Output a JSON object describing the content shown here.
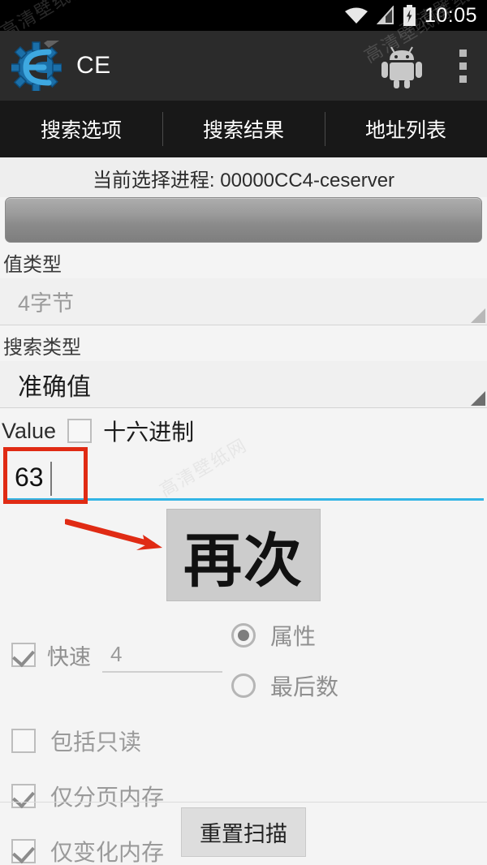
{
  "statusbar": {
    "time": "10:05",
    "icons": [
      "wifi-icon",
      "signal-icon",
      "battery-charging-icon"
    ]
  },
  "actionbar": {
    "logo_icon": "ce-gear-logo-icon",
    "title": "CE",
    "android_icon": "android-robot-icon",
    "overflow_icon": "overflow-menu-icon"
  },
  "tabs": [
    {
      "label": "搜索选项",
      "active": true
    },
    {
      "label": "搜索结果",
      "active": false
    },
    {
      "label": "地址列表",
      "active": false
    }
  ],
  "main": {
    "process_line": "当前选择进程: 00000CC4-ceserver",
    "process_button_label": "",
    "value_type": {
      "label": "值类型",
      "value": "4字节"
    },
    "search_type": {
      "label": "搜索类型",
      "value": "准确值"
    },
    "value_row": {
      "label": "Value",
      "hex_label": "十六进制",
      "hex_checked": false,
      "input_value": "63"
    },
    "scan_button_label": "再次",
    "fast": {
      "label": "快速",
      "checked": true,
      "input_value": "4"
    },
    "radios": [
      {
        "label": "属性",
        "selected": true
      },
      {
        "label": "最后数",
        "selected": false
      }
    ],
    "checkboxes": [
      {
        "label": "包括只读",
        "checked": false
      },
      {
        "label": "仅分页内存",
        "checked": true
      },
      {
        "label": "仅变化内存",
        "checked": true
      }
    ],
    "reset_button_label": "重置扫描"
  },
  "watermark": {
    "text": "高清壁纸网"
  },
  "colors": {
    "accent": "#33b5e5",
    "actionbar": "#2b2b2b",
    "tabbar": "#181818",
    "annotation_red": "#e02b14",
    "content_bg": "#f4f4f4"
  }
}
